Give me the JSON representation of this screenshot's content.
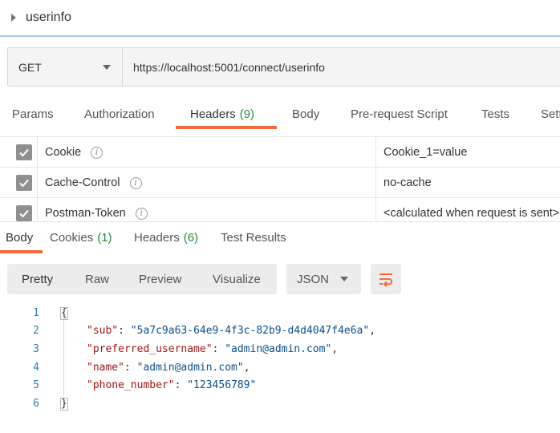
{
  "request": {
    "name": "userinfo",
    "method": "GET",
    "url": "https://localhost:5001/connect/userinfo"
  },
  "request_tabs": [
    {
      "label": "Params",
      "count": ""
    },
    {
      "label": "Authorization",
      "count": ""
    },
    {
      "label": "Headers",
      "count": "(9)"
    },
    {
      "label": "Body",
      "count": ""
    },
    {
      "label": "Pre-request Script",
      "count": ""
    },
    {
      "label": "Tests",
      "count": ""
    },
    {
      "label": "Setti",
      "count": ""
    }
  ],
  "active_request_tab": "Headers",
  "headers": [
    {
      "key": "Cookie",
      "value": "Cookie_1=value",
      "checked": true
    },
    {
      "key": "Cache-Control",
      "value": "no-cache",
      "checked": true
    },
    {
      "key": "Postman-Token",
      "value": "<calculated when request is sent>",
      "checked": true
    }
  ],
  "response_tabs": [
    {
      "label": "Body",
      "count": ""
    },
    {
      "label": "Cookies",
      "count": "(1)"
    },
    {
      "label": "Headers",
      "count": "(6)"
    },
    {
      "label": "Test Results",
      "count": ""
    }
  ],
  "active_response_tab": "Body",
  "view_modes": [
    "Pretty",
    "Raw",
    "Preview",
    "Visualize"
  ],
  "active_view_mode": "Pretty",
  "format": "JSON",
  "icons": {
    "request_caret": "caret-right-icon",
    "method_dropdown": "chevron-down-icon",
    "header_checkbox": "checkbox-checked-icon",
    "header_info": "info-icon",
    "format_dropdown": "chevron-down-icon",
    "wrap": "wrap-lines-icon"
  },
  "colors": {
    "accent_underline": "#f26b3a",
    "count_green": "#2a8a3e",
    "json_key": "#a31515",
    "json_string": "#0b4f8c",
    "line_number": "#2a7bb0",
    "title_rule": "#a9c6ee"
  },
  "code": {
    "line_numbers": [
      "1",
      "2",
      "3",
      "4",
      "5",
      "6"
    ],
    "open_brace": "{",
    "close_brace": "}",
    "fields": [
      {
        "key": "\"sub\"",
        "value": "\"5a7c9a63-64e9-4f3c-82b9-d4d4047f4e6a\"",
        "comma": ","
      },
      {
        "key": "\"preferred_username\"",
        "value": "\"admin@admin.com\"",
        "comma": ","
      },
      {
        "key": "\"name\"",
        "value": "\"admin@admin.com\"",
        "comma": ","
      },
      {
        "key": "\"phone_number\"",
        "value": "\"123456789\"",
        "comma": ""
      }
    ]
  }
}
